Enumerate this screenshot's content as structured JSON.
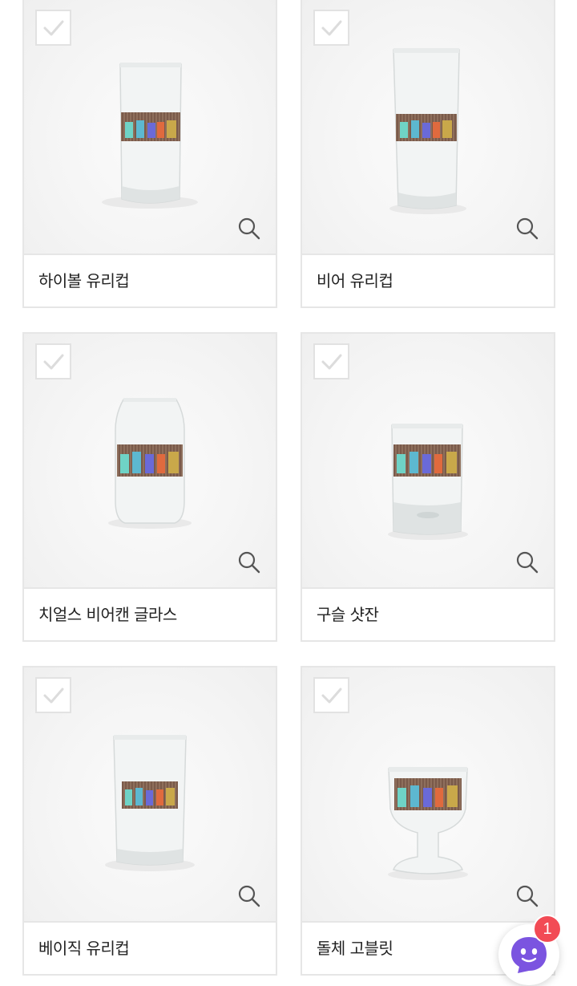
{
  "products": [
    {
      "name": "하이볼 유리컵",
      "glass": "highball"
    },
    {
      "name": "비어 유리컵",
      "glass": "beer"
    },
    {
      "name": "치얼스 비어캔 글라스",
      "glass": "beercan"
    },
    {
      "name": "구슬 샷잔",
      "glass": "shot"
    },
    {
      "name": "베이직 유리컵",
      "glass": "basic"
    },
    {
      "name": "돌체 고블릿",
      "glass": "goblet"
    }
  ],
  "chat": {
    "badge_count": "1",
    "icon": "chat-bot-icon"
  },
  "colors": {
    "border": "#e6e6e6",
    "badge": "#f24b55",
    "chat_icon": "#7b54e0",
    "text": "#222222"
  }
}
